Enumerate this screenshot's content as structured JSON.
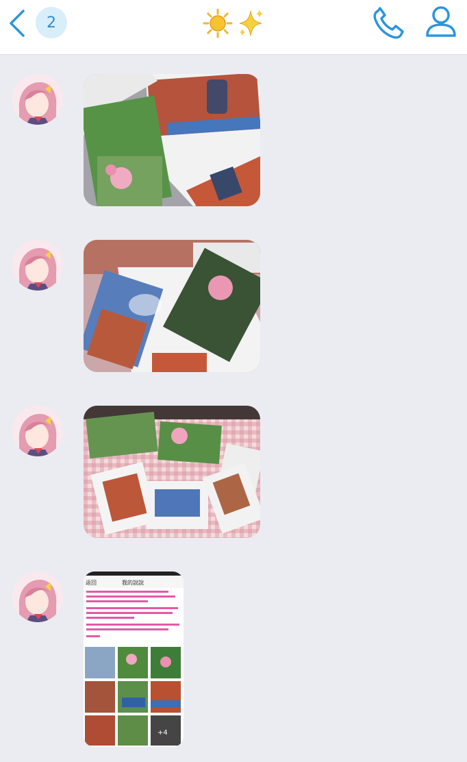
{
  "header": {
    "back_icon": "chevron-left-icon",
    "unread_count": "2",
    "title_icons": [
      "sun-icon",
      "sparkles-icon"
    ],
    "call_icon": "phone-icon",
    "profile_icon": "person-icon"
  },
  "messages": [
    {
      "sender_avatar": "anime-girl-avatar",
      "type": "image"
    },
    {
      "sender_avatar": "anime-girl-avatar",
      "type": "image"
    },
    {
      "sender_avatar": "anime-girl-avatar",
      "type": "image"
    },
    {
      "sender_avatar": "anime-girl-avatar",
      "type": "image",
      "screenshot": {
        "back_label": "返回",
        "title": "我的說說",
        "more_badge": "+4"
      }
    }
  ]
}
